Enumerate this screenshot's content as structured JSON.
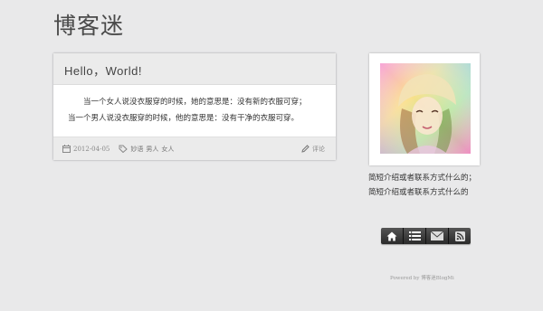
{
  "site": {
    "title": "博客迷"
  },
  "post": {
    "title": "Hello，World!",
    "paragraphs": [
      "当一个女人说没衣服穿的时候，她的意思是：没有新的衣服可穿；",
      "当一个男人说没衣服穿的时候，他的意思是：没有干净的衣服可穿。"
    ],
    "date": "2012-04-05",
    "category": "妙语",
    "tags": [
      "男人",
      "女人"
    ],
    "comment_label": "评论"
  },
  "sidebar": {
    "bio": "简短介绍或者联系方式什么的；简短介绍或者联系方式什么的",
    "social": [
      "home-icon",
      "list-icon",
      "mail-icon",
      "rss-icon"
    ]
  },
  "footer": {
    "powered_by": "Powered by",
    "brand": "博客迷BlogMi"
  },
  "colors": {
    "background": "#e9e9ea",
    "panel_header": "#ebebeb",
    "icon_bar": "#333333"
  }
}
